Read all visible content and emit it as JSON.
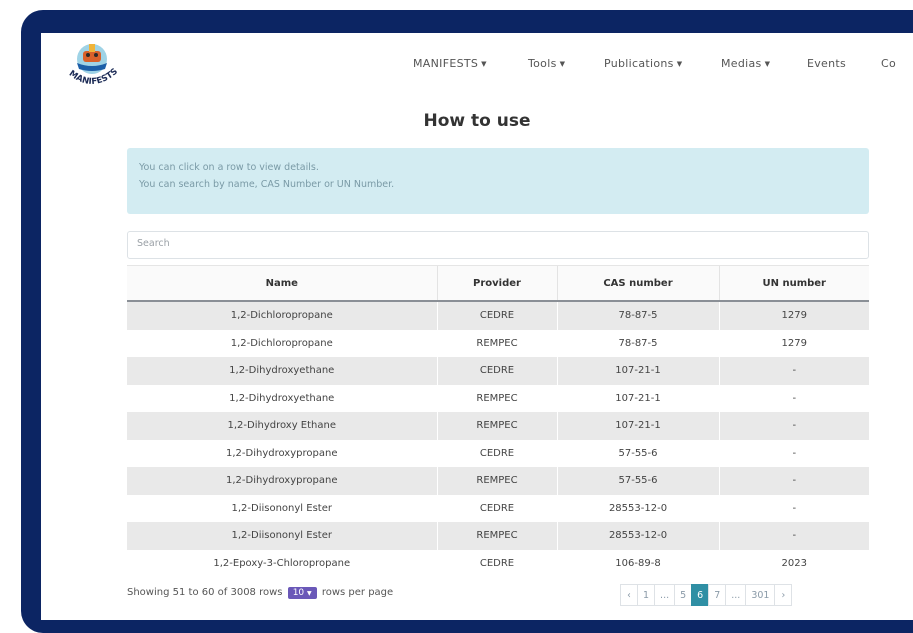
{
  "nav": {
    "logo_text": "MANIFESTS",
    "items": [
      {
        "label": "MANIFESTS",
        "caret": true
      },
      {
        "label": "Tools",
        "caret": true
      },
      {
        "label": "Publications",
        "caret": true
      },
      {
        "label": "Medias",
        "caret": true
      },
      {
        "label": "Events",
        "caret": false
      },
      {
        "label": "Co",
        "caret": false
      }
    ]
  },
  "page": {
    "title": "How to use",
    "info_lines": [
      "You can click on a row to view details.",
      "You can search by name, CAS Number or UN Number."
    ]
  },
  "search": {
    "placeholder": "Search"
  },
  "table": {
    "headers": [
      "Name",
      "Provider",
      "CAS number",
      "UN number"
    ],
    "rows": [
      [
        "1,2-Dichloropropane",
        "CEDRE",
        "78-87-5",
        "1279"
      ],
      [
        "1,2-Dichloropropane",
        "REMPEC",
        "78-87-5",
        "1279"
      ],
      [
        "1,2-Dihydroxyethane",
        "CEDRE",
        "107-21-1",
        "-"
      ],
      [
        "1,2-Dihydroxyethane",
        "REMPEC",
        "107-21-1",
        "-"
      ],
      [
        "1,2-Dihydroxy Ethane",
        "REMPEC",
        "107-21-1",
        "-"
      ],
      [
        "1,2-Dihydroxypropane",
        "CEDRE",
        "57-55-6",
        "-"
      ],
      [
        "1,2-Dihydroxypropane",
        "REMPEC",
        "57-55-6",
        "-"
      ],
      [
        "1,2-Diisononyl Ester",
        "CEDRE",
        "28553-12-0",
        "-"
      ],
      [
        "1,2-Diisononyl Ester",
        "REMPEC",
        "28553-12-0",
        "-"
      ],
      [
        "1,2-Epoxy-3-Chloropropane",
        "CEDRE",
        "106-89-8",
        "2023"
      ]
    ]
  },
  "footer": {
    "showing": "Showing 51 to 60 of 3008 rows",
    "rows_per_page_value": "10",
    "rows_per_page_label": "rows per page"
  },
  "pagination": [
    {
      "label": "‹",
      "active": false
    },
    {
      "label": "1",
      "active": false
    },
    {
      "label": "...",
      "active": false
    },
    {
      "label": "5",
      "active": false
    },
    {
      "label": "6",
      "active": true
    },
    {
      "label": "7",
      "active": false
    },
    {
      "label": "...",
      "active": false
    },
    {
      "label": "301",
      "active": false
    },
    {
      "label": "›",
      "active": false
    }
  ],
  "colors": {
    "frame": "#0c2563",
    "info_bg": "#d3ecf2",
    "active_page": "#2f8fa4",
    "rows_per_page_badge": "#6a58b8"
  }
}
